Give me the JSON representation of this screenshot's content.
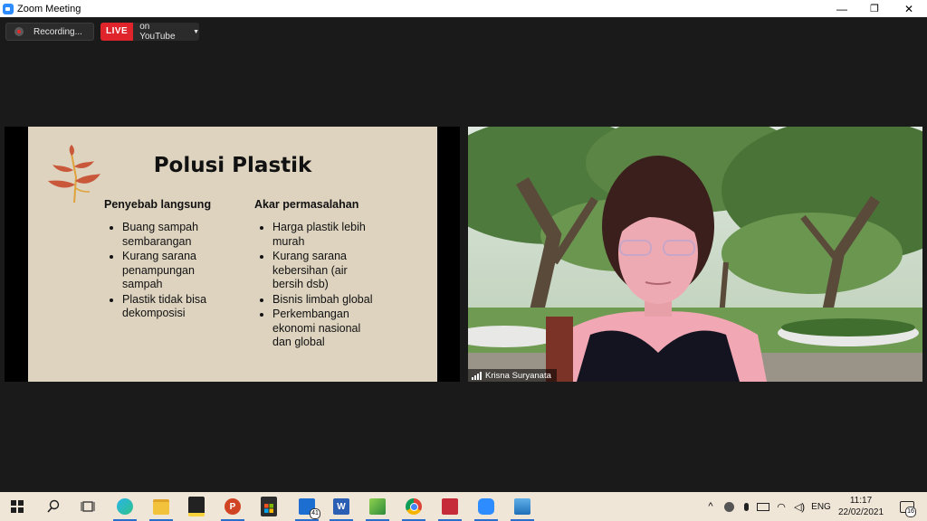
{
  "window": {
    "title": "Zoom Meeting",
    "controls": {
      "minimize": "—",
      "restore": "❐",
      "close": "✕"
    }
  },
  "meeting_controls": {
    "recording_label": "Recording...",
    "live_badge": "LIVE",
    "live_target": "on YouTube"
  },
  "slide": {
    "title": "Polusi Plastik",
    "left_column": {
      "heading": "Penyebab langsung",
      "items": [
        "Buang sampah sembarangan",
        "Kurang sarana penampungan sampah",
        "Plastik tidak bisa dekomposisi"
      ]
    },
    "right_column": {
      "heading": "Akar permasalahan",
      "items": [
        "Harga plastik lebih murah",
        "Kurang sarana kebersihan (air bersih dsb)",
        "Bisnis limbah global",
        "Perkembangan ekonomi nasional dan global"
      ]
    }
  },
  "participant": {
    "name": "Krisna Suryanata"
  },
  "taskbar": {
    "apps": [
      {
        "icon": "windows-start-icon"
      },
      {
        "icon": "search-icon"
      },
      {
        "icon": "task-view-icon"
      },
      {
        "icon": "edge-browser-icon"
      },
      {
        "icon": "file-explorer-icon"
      },
      {
        "icon": "sticky-notes-icon"
      },
      {
        "icon": "powerpoint-icon"
      },
      {
        "icon": "store-icon"
      },
      {
        "icon": "mail-icon",
        "badge": "41"
      },
      {
        "icon": "word-icon"
      },
      {
        "icon": "green-app-icon"
      },
      {
        "icon": "chrome-icon"
      },
      {
        "icon": "red-app-icon"
      },
      {
        "icon": "zoom-icon"
      },
      {
        "icon": "photos-icon"
      }
    ],
    "tray": {
      "language": "ENG",
      "time": "11:17",
      "date": "22/02/2021",
      "notification_count": "16"
    }
  },
  "colors": {
    "zoom_blue": "#2d8cff",
    "live_red": "#e0242b",
    "slide_bg": "#ddd3bf",
    "taskbar_bg": "#f0e6d8"
  }
}
